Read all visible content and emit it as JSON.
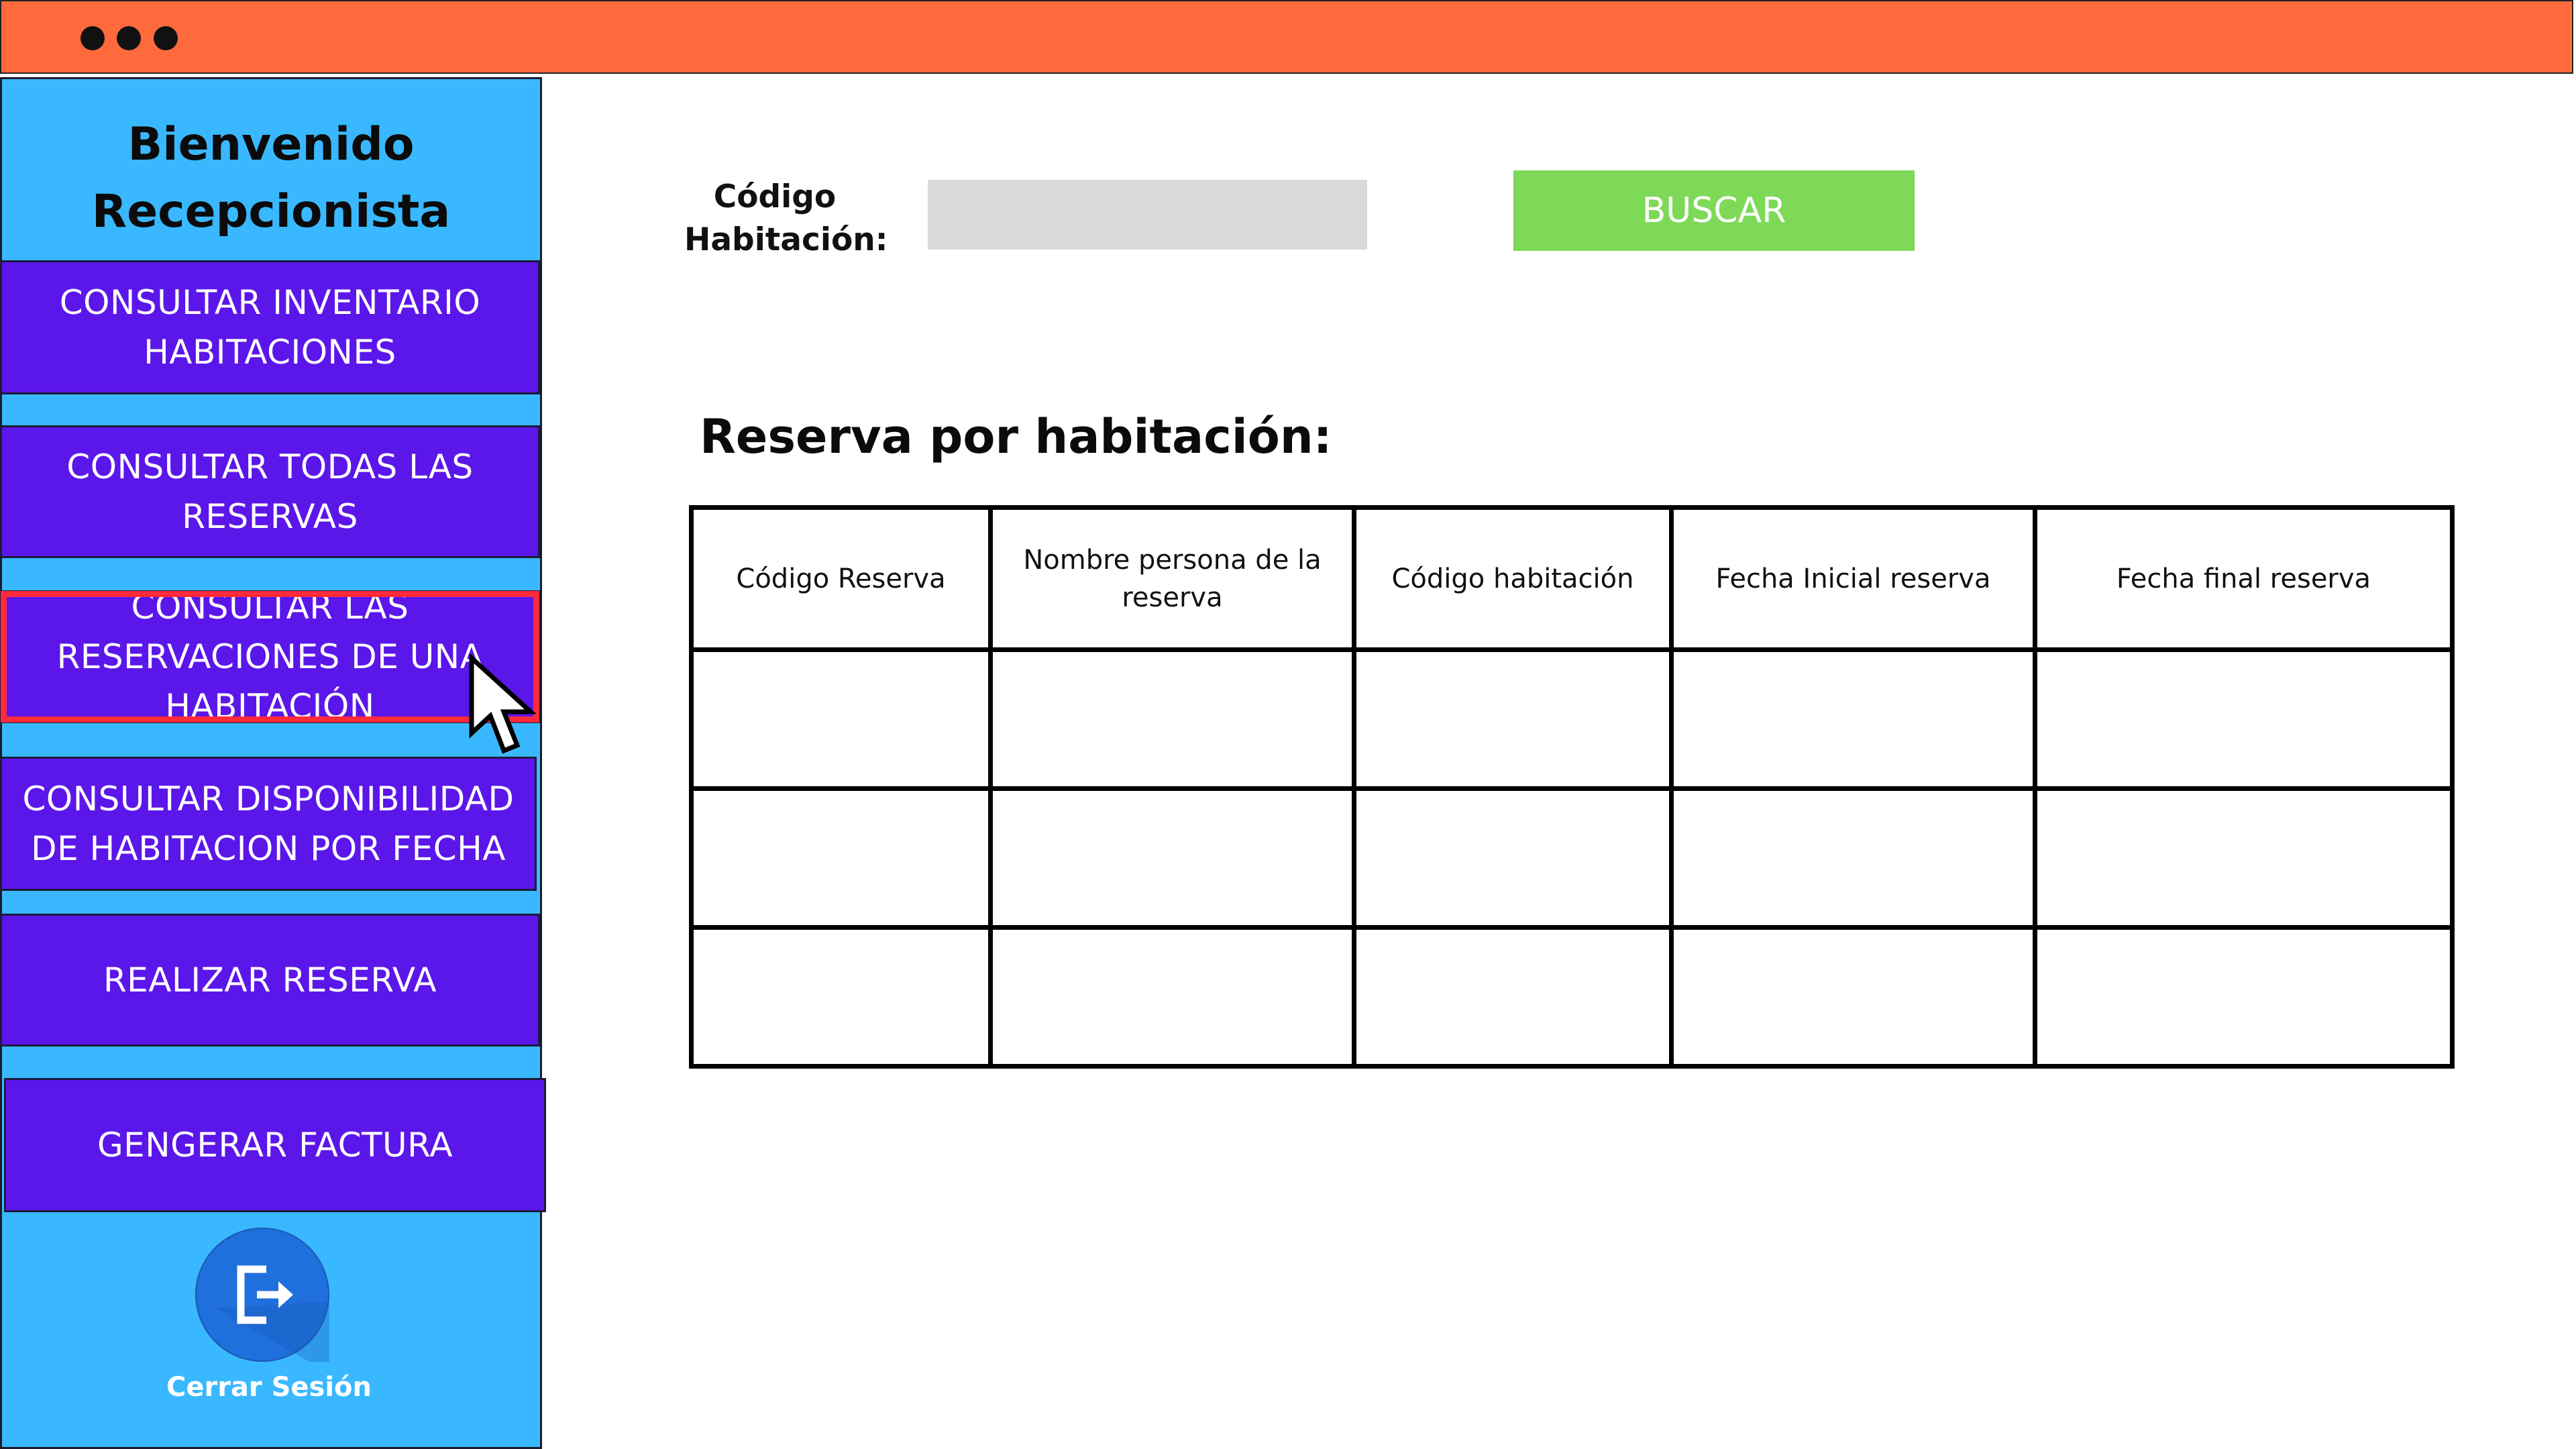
{
  "sidebar": {
    "welcome_line1": "Bienvenido",
    "welcome_line2": "Recepcionista",
    "menu": [
      "CONSULTAR INVENTARIO HABITACIONES",
      "CONSULTAR TODAS LAS RESERVAS",
      "CONSULTAR LAS RESERVACIONES DE UNA HABITACIÓN",
      "CONSULTAR DISPONIBILIDAD DE HABITACION POR FECHA",
      "REALIZAR RESERVA",
      "GENGERAR FACTURA"
    ],
    "logout_label": "Cerrar Sesión"
  },
  "search": {
    "label": "Código Habitación:",
    "value": "",
    "button": "BUSCAR"
  },
  "section_title": "Reserva por habitación:",
  "table": {
    "headers": [
      "Código Reserva",
      "Nombre persona de la reserva",
      "Código habitación",
      "Fecha Inicial reserva",
      "Fecha final reserva"
    ],
    "rows": [
      [
        "",
        "",
        "",
        "",
        ""
      ],
      [
        "",
        "",
        "",
        "",
        ""
      ],
      [
        "",
        "",
        "",
        "",
        ""
      ]
    ]
  },
  "colors": {
    "titlebar": "#ff6a3d",
    "sidebar": "#3ab8ff",
    "menu_button": "#5b16ea",
    "selected_outline": "#ff2a3a",
    "search_button": "#7ed957"
  }
}
